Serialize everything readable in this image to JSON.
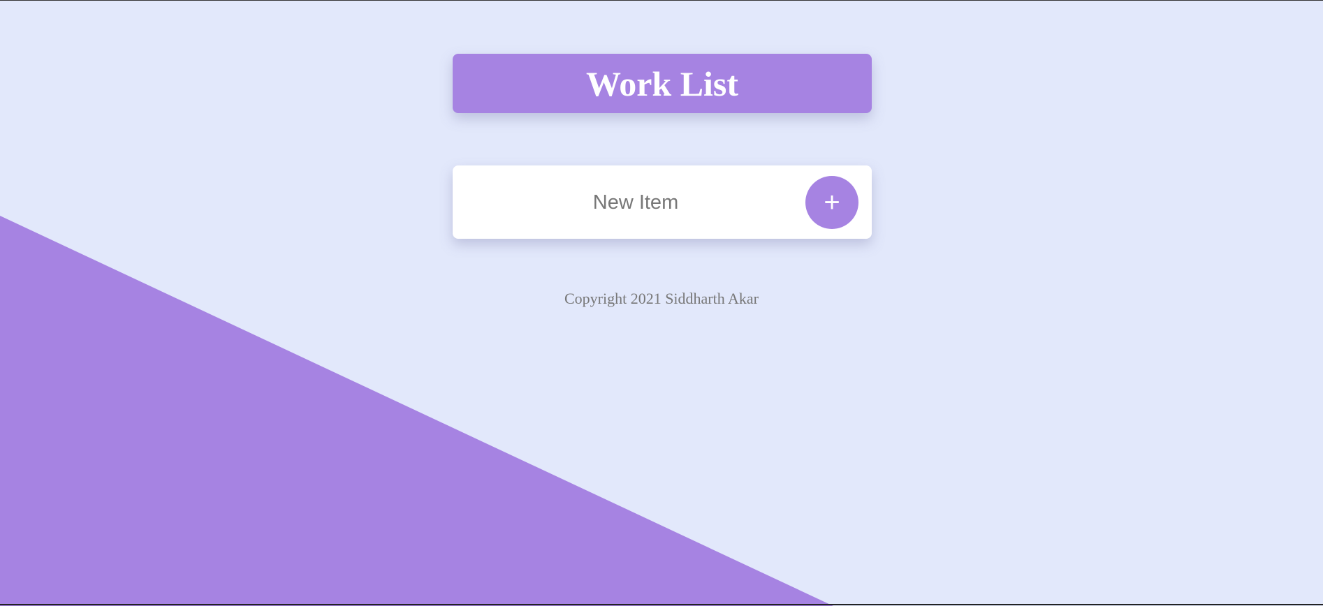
{
  "header": {
    "title": "Work List"
  },
  "new_item": {
    "placeholder": "New Item",
    "add_label": "+"
  },
  "footer": {
    "copyright": "Copyright 2021 Siddharth Akar"
  },
  "colors": {
    "accent": "#a683e2",
    "background": "#e2e8fb"
  }
}
